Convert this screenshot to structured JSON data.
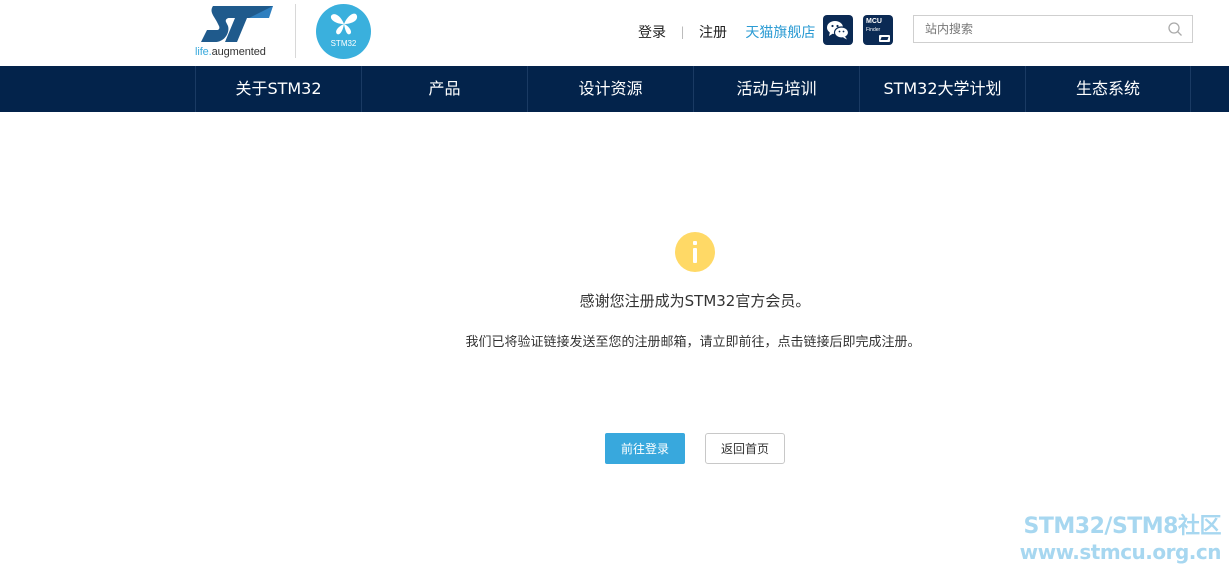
{
  "branding": {
    "st_tagline_prefix": "life.",
    "st_tagline_suffix": "augmented",
    "stm32_logo_text": "STM32",
    "mcu_finder_line1": "MCU",
    "mcu_finder_line2": "Finder"
  },
  "top_links": {
    "login": "登录",
    "separator": "|",
    "register": "注册",
    "tmall": "天猫旗舰店"
  },
  "search": {
    "placeholder": "站内搜索",
    "value": ""
  },
  "nav": {
    "items": [
      {
        "label": "关于STM32"
      },
      {
        "label": "产品"
      },
      {
        "label": "设计资源"
      },
      {
        "label": "活动与培训"
      },
      {
        "label": "STM32大学计划"
      },
      {
        "label": "生态系统"
      }
    ]
  },
  "main": {
    "title": "感谢您注册成为STM32官方会员。",
    "message": "我们已将验证链接发送至您的注册邮箱，请立即前往，点击链接后即完成注册。",
    "login_button": "前往登录",
    "home_button": "返回首页"
  },
  "watermark": {
    "line1": "STM32/STM8社区",
    "line2": "www.stmcu.org.cn"
  },
  "colors": {
    "nav_bg": "#03234b",
    "accent_blue": "#38a8dd",
    "info_yellow": "#ffd966",
    "link_blue": "#2b9bd3"
  }
}
